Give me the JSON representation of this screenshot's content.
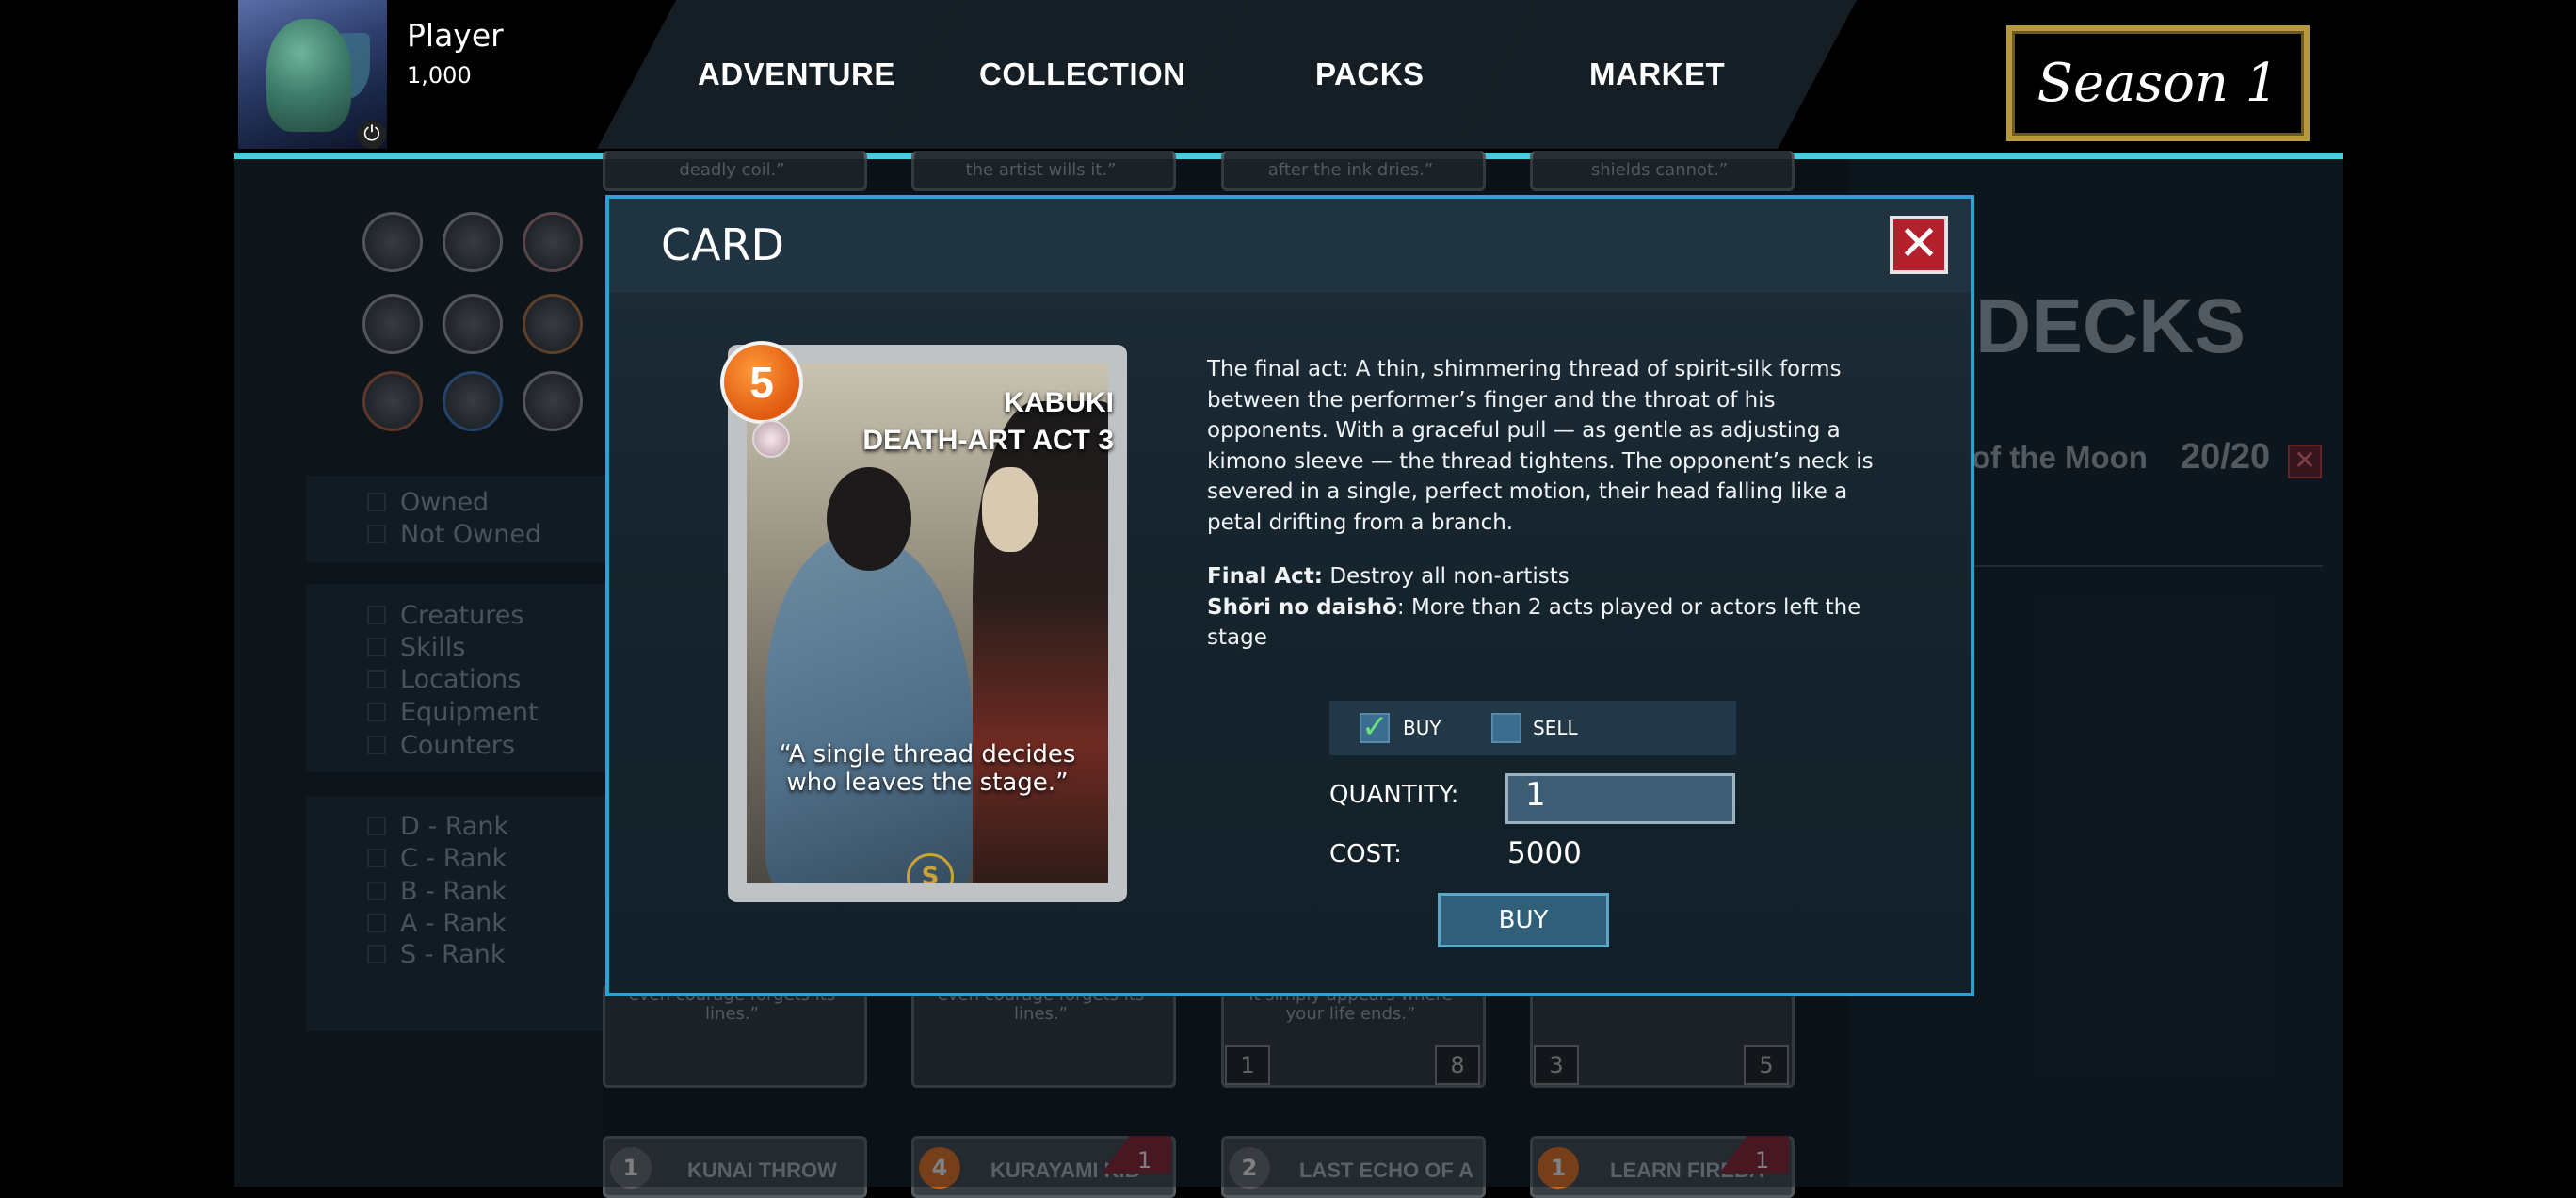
{
  "player": {
    "name": "Player",
    "coins": "1,000",
    "power_icon": "power-icon"
  },
  "nav": [
    "ADVENTURE",
    "COLLECTION",
    "PACKS",
    "MARKET"
  ],
  "season": "Season 1",
  "filters": {
    "ownership": [
      "Owned",
      "Not Owned"
    ],
    "types": [
      "Creatures",
      "Skills",
      "Locations",
      "Equipment",
      "Counters"
    ],
    "ranks": [
      "D - Rank",
      "C - Rank",
      "B - Rank",
      "A - Rank",
      "S - Rank"
    ]
  },
  "background_cards": {
    "top_quotes": [
      "deadly coil.”",
      "the artist wills it.”",
      "after the ink dries.”",
      "shields cannot.”"
    ],
    "mid_quotes": [
      {
        "l1": "even courage forgets its",
        "l2": "lines.”"
      },
      {
        "l1": "even courage forgets its",
        "l2": "lines.”"
      },
      {
        "l1": "it simply appears where",
        "l2": "your life ends.”"
      }
    ],
    "mid_numbers": [
      {
        "left": "1",
        "right": "8"
      },
      {
        "left": "3",
        "right": "5"
      }
    ],
    "bottom": [
      {
        "cost": "1",
        "name": "KUNAI THROW",
        "badge": ""
      },
      {
        "cost": "4",
        "name": "KURAYAMI KIB",
        "badge": "1"
      },
      {
        "cost": "2",
        "name": "LAST ECHO OF A",
        "badge": ""
      },
      {
        "cost": "1",
        "name": "LEARN FIREBA",
        "badge": "1"
      }
    ]
  },
  "decks": {
    "title": "DECKS",
    "name": "of the Moon",
    "count": "20/20"
  },
  "modal": {
    "title": "CARD",
    "card": {
      "cost": "5",
      "title_line1": "KABUKI",
      "title_line2": "DEATH-ART ACT 3",
      "quote_line1": "“A single thread decides",
      "quote_line2": "who leaves the stage.”",
      "currency_symbol": "S"
    },
    "description": "The final act:  A thin, shimmering thread of spirit-silk forms between the performer’s finger and the throat of his opponents. With a graceful pull — as gentle as adjusting a kimono sleeve — the thread tightens. The opponent’s neck is severed in a single, perfect motion, their head falling like a petal drifting from a branch.",
    "abilities": [
      {
        "name": "Final Act:",
        "text": " Destroy all non-artists"
      },
      {
        "name": "Shōri no daishō",
        "text": ": More than 2 acts played or actors left the stage"
      }
    ],
    "buy_label": "BUY",
    "sell_label": "SELL",
    "quantity_label": "QUANTITY:",
    "quantity_value": "1",
    "cost_label": "COST:",
    "cost_value": "5000",
    "buy_button": "BUY"
  },
  "colors": {
    "accent": "#3fd1df",
    "modal_border": "#2f9fd6",
    "close": "#b5202d",
    "cost_orb": "#e05a10",
    "season_frame": "#b89a3c"
  }
}
